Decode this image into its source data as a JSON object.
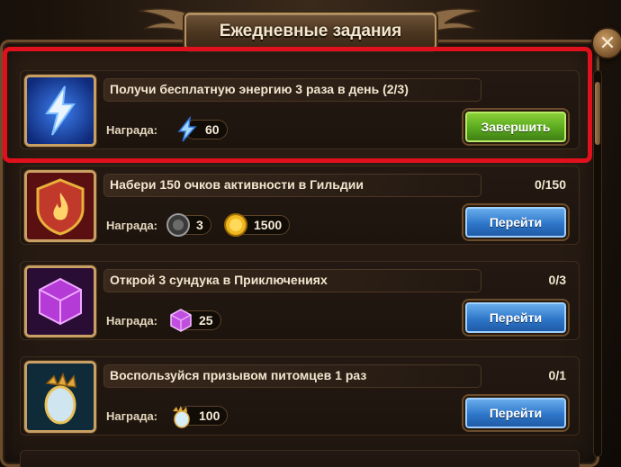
{
  "window": {
    "title": "Ежедневные задания",
    "close_icon": "close-icon"
  },
  "reward_label": "Награда:",
  "colors": {
    "highlight": "#e0101d",
    "complete_button": "#58a81e",
    "go_button": "#2e76c9"
  },
  "quests": [
    {
      "title": "Получи бесплатную энергию 3 раза в день (2/3)",
      "progress": "",
      "icon": "energy-bolt-icon",
      "rewards": [
        {
          "icon": "energy-icon",
          "amount": "60"
        }
      ],
      "button_label": "Завершить",
      "highlighted": true
    },
    {
      "title": "Набери 150 очков активности в Гильдии",
      "progress": "0/150",
      "icon": "guild-activity-icon",
      "rewards": [
        {
          "icon": "guild-token-icon",
          "amount": "3"
        },
        {
          "icon": "gold-coin-icon",
          "amount": "1500"
        }
      ],
      "button_label": "Перейти"
    },
    {
      "title": "Открой 3 сундука в Приключениях",
      "progress": "0/3",
      "icon": "purple-chest-icon",
      "rewards": [
        {
          "icon": "purple-cube-icon",
          "amount": "25"
        }
      ],
      "button_label": "Перейти"
    },
    {
      "title": "Воспользуйся призывом питомцев 1 раз",
      "progress": "0/1",
      "icon": "pet-egg-icon",
      "rewards": [
        {
          "icon": "pet-egg-small-icon",
          "amount": "100"
        }
      ],
      "button_label": "Перейти"
    }
  ]
}
